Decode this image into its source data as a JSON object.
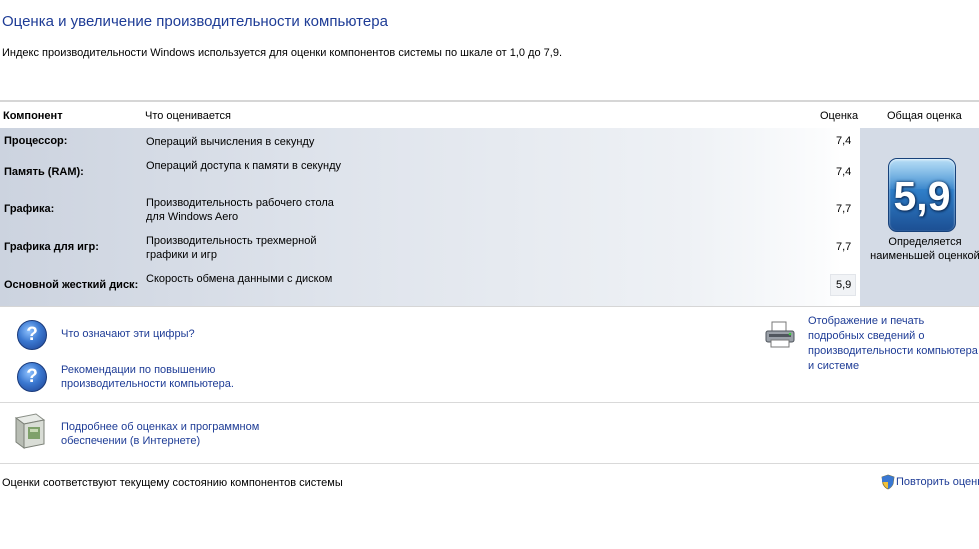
{
  "title": "Оценка и увеличение производительности компьютера",
  "description": "Индекс производительности Windows используется для оценки компонентов системы по шкале от 1,0 до 7,9.",
  "table": {
    "headers": {
      "component": "Компонент",
      "what": "Что оценивается",
      "score": "Оценка",
      "total": "Общая оценка"
    },
    "rows": [
      {
        "component": "Процессор:",
        "what": "Операций вычисления в секунду",
        "score": "7,4"
      },
      {
        "component": "Память (RAM):",
        "what": "Операций доступа к памяти в секунду",
        "score": "7,4"
      },
      {
        "component": "Графика:",
        "what": "Производительность рабочего стола для Windows Aero",
        "score": "7,7"
      },
      {
        "component": "Графика для игр:",
        "what": "Производительность трехмерной графики и игр",
        "score": "7,7"
      },
      {
        "component": "Основной жесткий диск:",
        "what": "Скорость обмена данными с диском",
        "score": "5,9"
      }
    ],
    "base_score": "5,9",
    "base_score_label": "Определяется наименьшей оценкой"
  },
  "links": {
    "what_numbers_mean": "Что означают эти цифры?",
    "tips": "Рекомендации по повышению производительности компьютера.",
    "print_details": "Отображение и печать подробных сведений о производительности компьютера и системе",
    "more_info": "Подробнее об оценках и программном обеспечении (в Интернете)"
  },
  "status": "Оценки соответствуют текущему состоянию компонентов системы",
  "rerun_label": "Повторить оценку",
  "icons": {
    "help": "help-icon",
    "printer": "printer-icon",
    "software": "software-box-icon",
    "shield": "uac-shield-icon"
  },
  "colors": {
    "link": "#1e3c96",
    "badge": "#2e7dc7"
  }
}
